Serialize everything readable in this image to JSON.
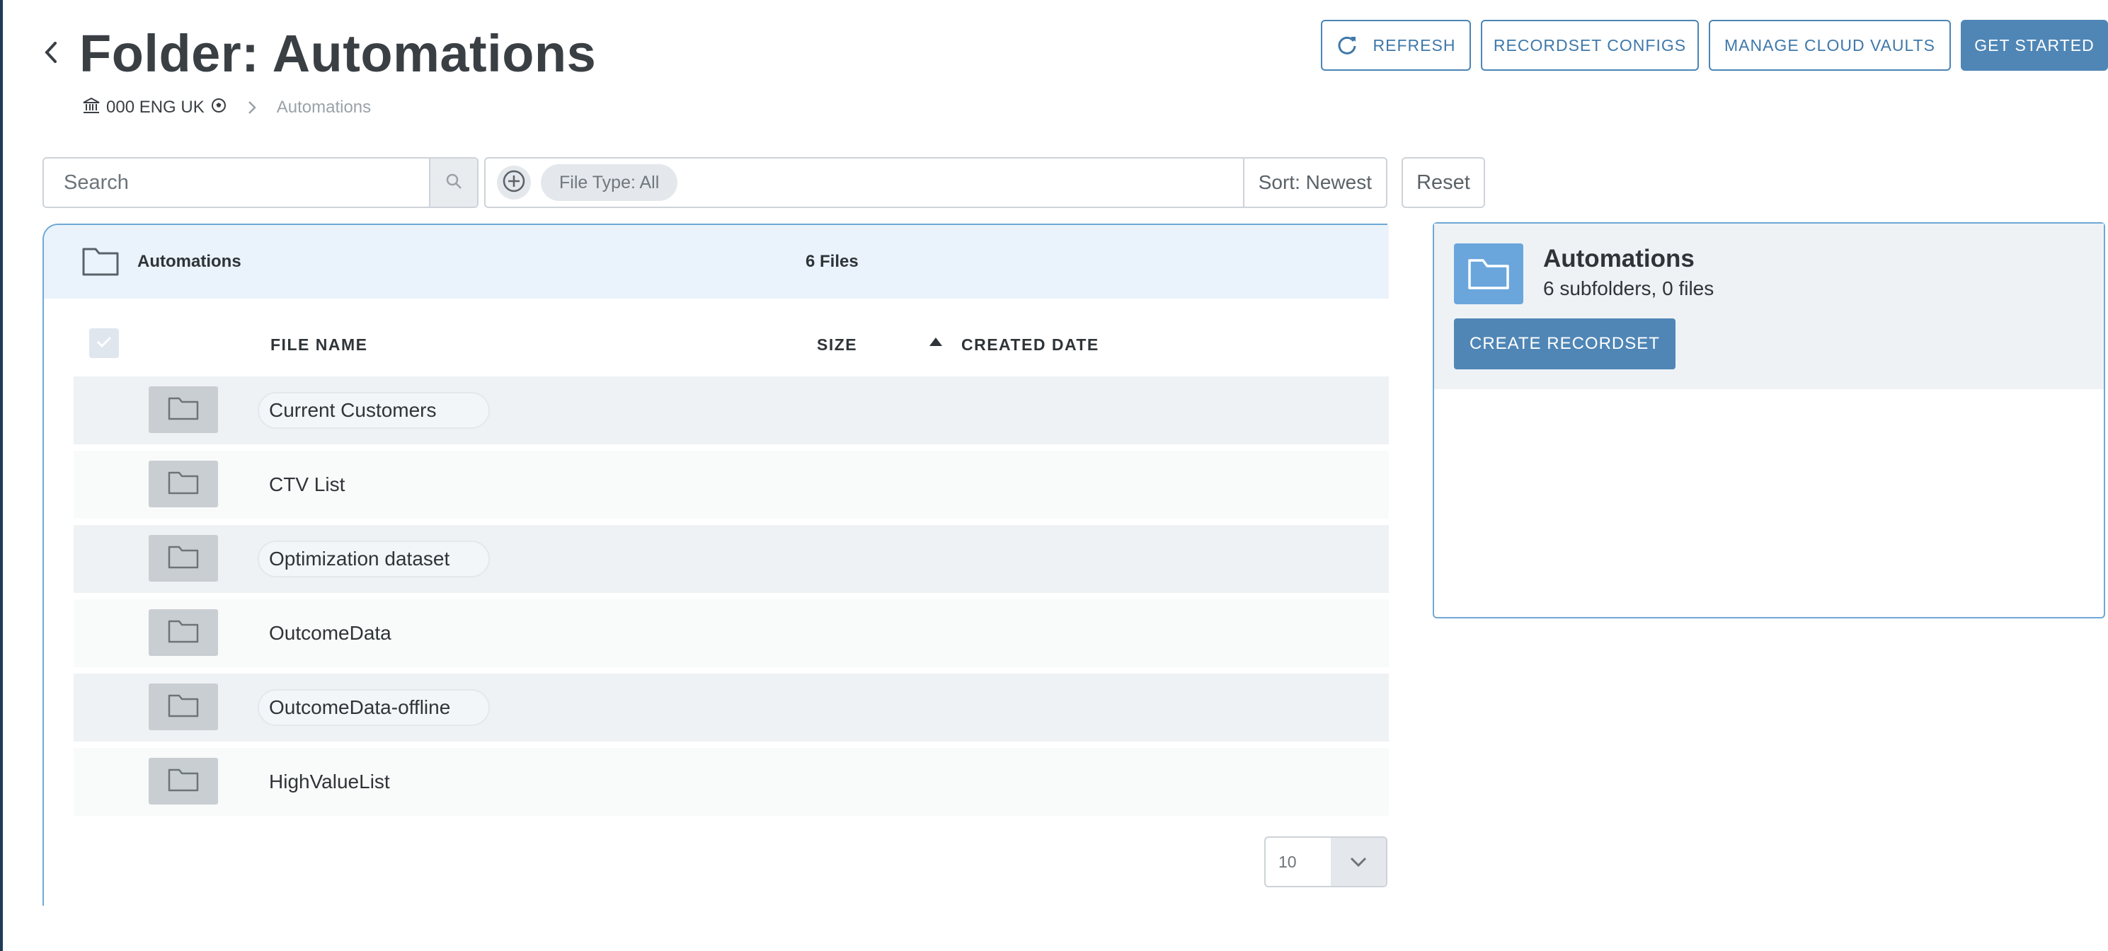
{
  "header": {
    "title": "Folder: Automations",
    "breadcrumb": {
      "org": "000 ENG UK",
      "current": "Automations"
    },
    "buttons": {
      "refresh": "REFRESH",
      "recordset_configs": "RECORDSET CONFIGS",
      "manage_cloud_vaults": "MANAGE CLOUD VAULTS",
      "get_started": "GET STARTED"
    }
  },
  "filters": {
    "search_placeholder": "Search",
    "file_type_chip": "File Type: All",
    "sort": "Sort: Newest",
    "reset": "Reset"
  },
  "folder": {
    "name": "Automations",
    "count": "6 Files"
  },
  "table": {
    "columns": {
      "file_name": "FILE NAME",
      "size": "SIZE",
      "created_date": "CREATED DATE"
    },
    "rows": [
      {
        "name": "Current Customers"
      },
      {
        "name": "CTV List"
      },
      {
        "name": "Optimization dataset"
      },
      {
        "name": "OutcomeData"
      },
      {
        "name": "OutcomeData-offline"
      },
      {
        "name": "HighValueList"
      }
    ],
    "page_size": "10"
  },
  "details": {
    "title": "Automations",
    "subtitle": "6 subfolders, 0 files",
    "create_button": "CREATE RECORDSET"
  },
  "colors": {
    "accent": "#4f86b6",
    "accent_border": "#6fa8d6",
    "folder_icon": "#6aa6dc"
  }
}
